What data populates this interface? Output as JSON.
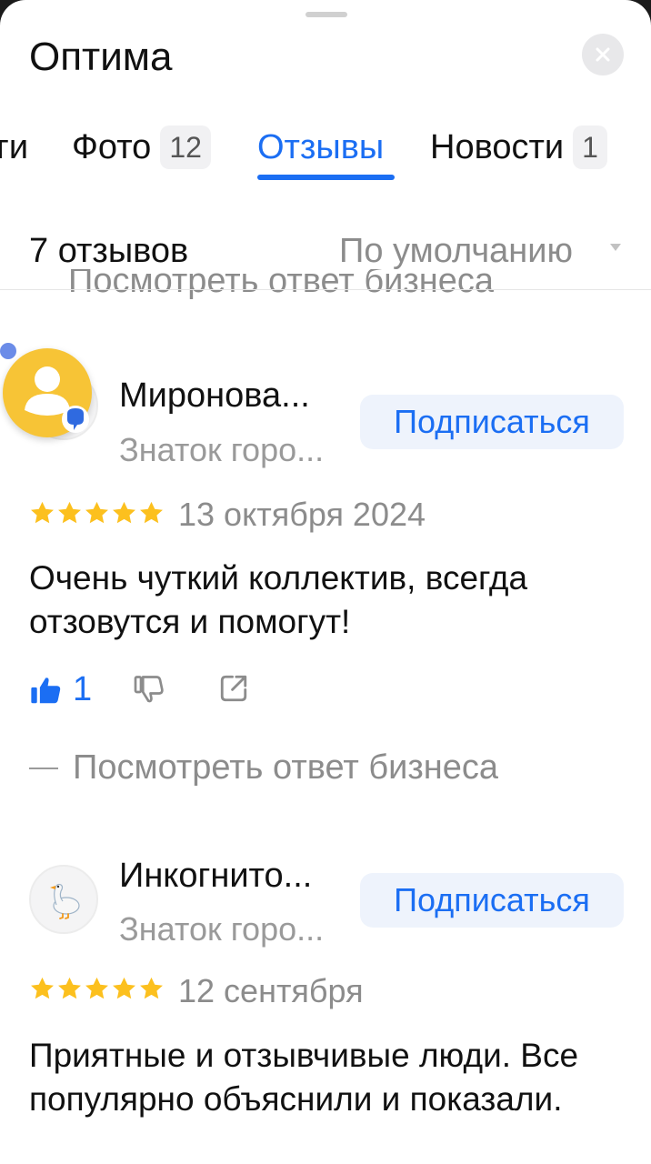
{
  "header": {
    "title": "Оптима"
  },
  "tabs": [
    {
      "label": "ги"
    },
    {
      "label": "Фото",
      "badge": "12"
    },
    {
      "label": "Отзывы",
      "active": true
    },
    {
      "label": "Новости",
      "badge": "1"
    }
  ],
  "reviews_header": {
    "count": "7 отзывов",
    "sort": "По умолчанию"
  },
  "clipped_link": "Посмотреть ответ бизнеса",
  "reviews": [
    {
      "name": "Миронова...",
      "level": "Знаток горо...",
      "subscribe": "Подписаться",
      "rating": 5,
      "date": "13 октября 2024",
      "text": "Очень чуткий коллектив, всегда отзовутся и помогут!",
      "likes": "1",
      "business_reply": "Посмотреть ответ бизнеса"
    },
    {
      "name": "Инкогнито...",
      "level": "Знаток горо...",
      "subscribe": "Подписаться",
      "rating": 5,
      "date": "12 сентября",
      "text": "Приятные и отзывчивые люди. Все популярно объяснили и показали."
    }
  ],
  "colors": {
    "accent": "#1b6ef3",
    "star": "#fcc01e",
    "muted": "#8c8c8c",
    "subscribe_bg": "#eef3fc"
  },
  "icons": [
    "close-icon",
    "like-icon",
    "dislike-icon",
    "share-icon",
    "star-icon",
    "goose-avatar-icon",
    "alice-assistant-icon",
    "sort-caret-icon"
  ]
}
